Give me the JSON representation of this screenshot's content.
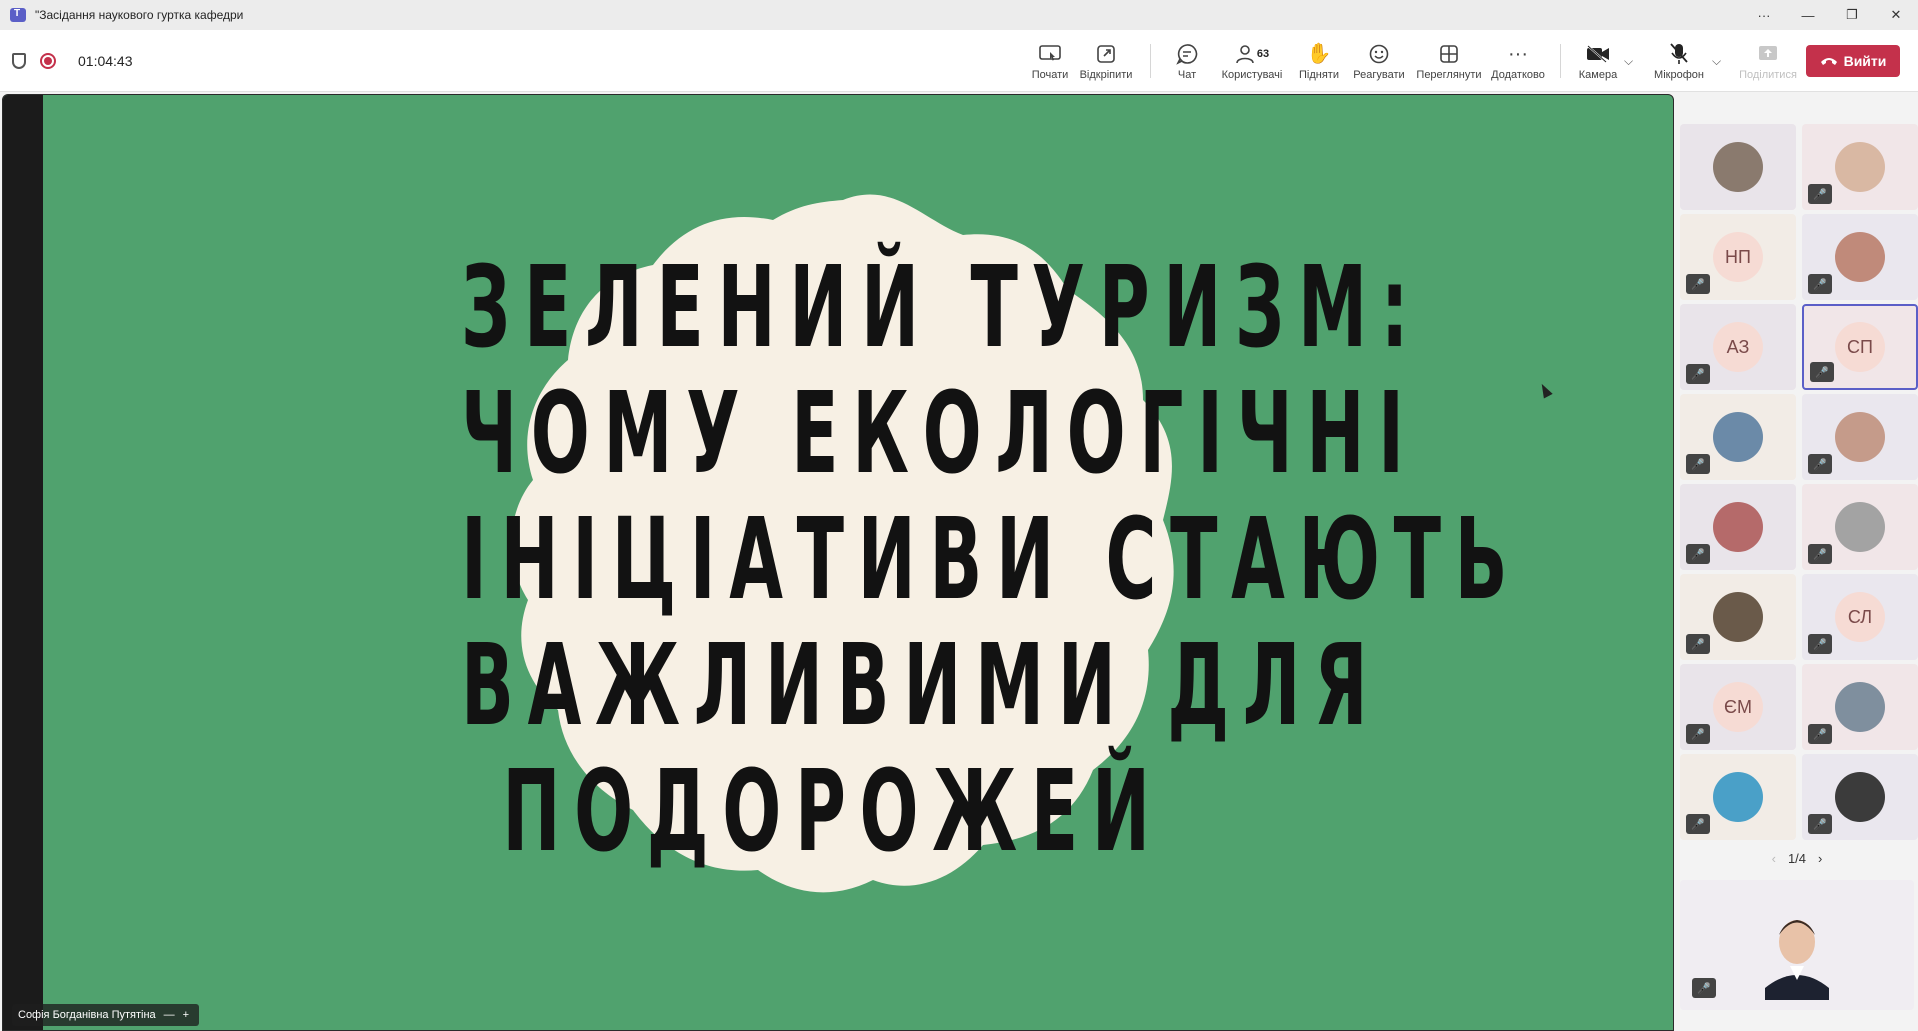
{
  "window": {
    "title": "\"Засідання наукового гуртка кафедри",
    "controls": [
      "···",
      "—",
      "❐",
      "✕"
    ]
  },
  "toolbar": {
    "timer": "01:04:43",
    "buttons": {
      "start": "Почати",
      "popout": "Відкріпити",
      "chat": "Чат",
      "people": "Користувачі",
      "people_count": "63",
      "raise": "Підняти",
      "react": "Реагувати",
      "view": "Переглянути",
      "more": "Додатково",
      "camera": "Камера",
      "mic": "Мікрофон",
      "share": "Поділитися"
    },
    "leave": "Вийти"
  },
  "slide": {
    "title_lines": [
      "ЗЕЛЕНИЙ ТУРИЗМ:",
      "ЧОМУ ЕКОЛОГІЧНІ",
      "ІНІЦІАТИВИ СТАЮТЬ",
      "ВАЖЛИВИМИ ДЛЯ",
      "ПОДОРОЖЕЙ"
    ],
    "background_color": "#50a26e",
    "blob_color": "#f7f0e4"
  },
  "presenter": {
    "name": "Софія Богданівна Путятіна"
  },
  "gallery": {
    "tiles": [
      {
        "initials": ""
      },
      {
        "initials": ""
      },
      {
        "initials": "НП"
      },
      {
        "initials": ""
      },
      {
        "initials": "АЗ"
      },
      {
        "initials": "СП"
      },
      {
        "initials": ""
      },
      {
        "initials": ""
      },
      {
        "initials": ""
      },
      {
        "initials": ""
      },
      {
        "initials": ""
      },
      {
        "initials": "СЛ"
      },
      {
        "initials": "ЄМ"
      },
      {
        "initials": ""
      },
      {
        "initials": ""
      },
      {
        "initials": ""
      }
    ],
    "pager": "1/4"
  }
}
